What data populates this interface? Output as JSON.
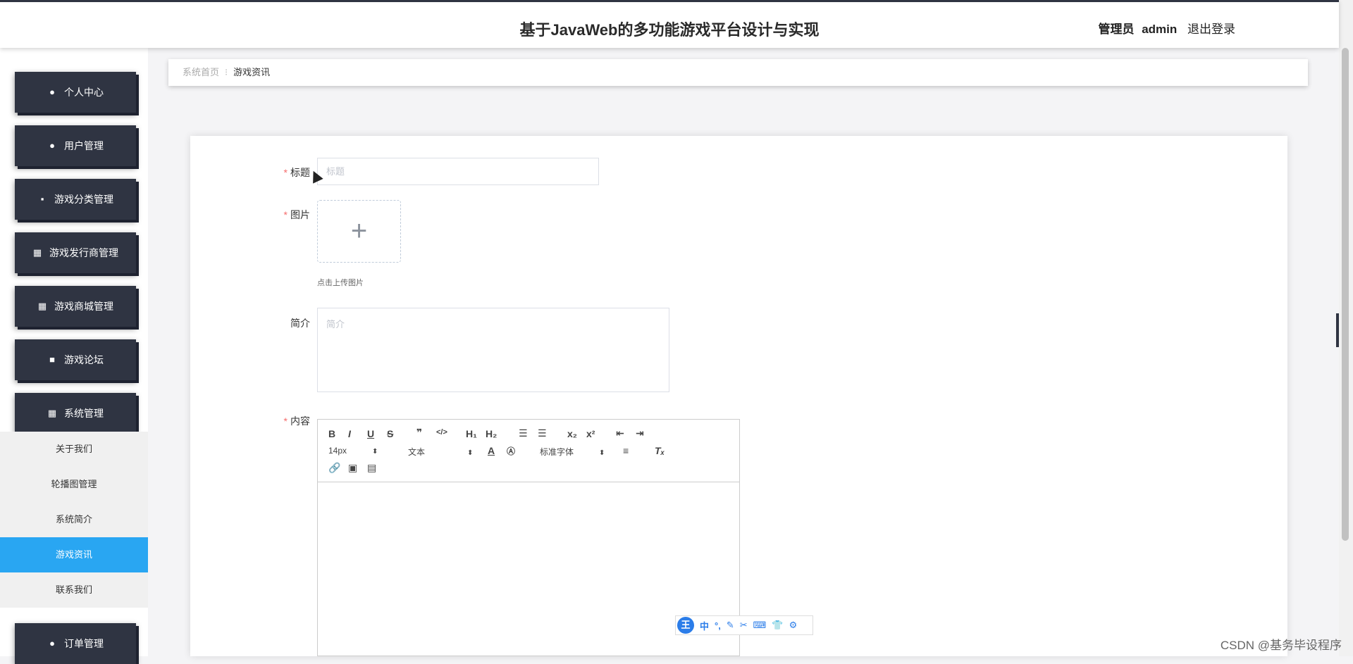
{
  "header": {
    "title": "基于JavaWeb的多功能游戏平台设计与实现",
    "role": "管理员",
    "username": "admin",
    "logout": "退出登录"
  },
  "sidebar": {
    "menu": [
      {
        "label": "个人中心",
        "icon": "user-icon"
      },
      {
        "label": "用户管理",
        "icon": "user-icon"
      },
      {
        "label": "游戏分类管理",
        "icon": "chat-icon"
      },
      {
        "label": "游戏发行商管理",
        "icon": "grid-icon"
      },
      {
        "label": "游戏商城管理",
        "icon": "grid-icon"
      },
      {
        "label": "游戏论坛",
        "icon": "briefcase-icon"
      },
      {
        "label": "系统管理",
        "icon": "grid-icon"
      }
    ],
    "submenu": [
      "关于我们",
      "轮播图管理",
      "系统简介",
      "游戏资讯",
      "联系我们"
    ],
    "active_sub": "游戏资讯",
    "order": {
      "label": "订单管理",
      "icon": "user-icon"
    }
  },
  "breadcrumb": {
    "home": "系统首页",
    "current": "游戏资讯"
  },
  "form": {
    "title_label": "标题",
    "title_placeholder": "标题",
    "image_label": "图片",
    "upload_tip": "点击上传图片",
    "intro_label": "简介",
    "intro_placeholder": "简介",
    "content_label": "内容"
  },
  "editor": {
    "font_size": "14px",
    "text_type": "文本",
    "font_family": "标准字体"
  },
  "ime": {
    "logo": "王",
    "items": [
      "中",
      "°,",
      "✎",
      "✂",
      "⌨",
      "👕",
      "⚙"
    ]
  },
  "watermark": "CSDN @基务毕设程序"
}
